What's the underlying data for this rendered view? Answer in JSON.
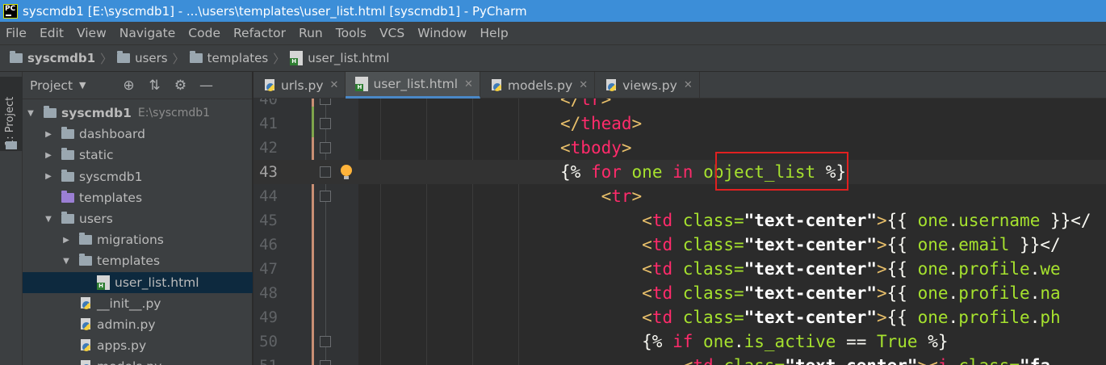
{
  "window": {
    "title": "syscmdb1 [E:\\syscmdb1] - ...\\users\\templates\\user_list.html [syscmdb1] - PyCharm",
    "app_icon_text": "PC"
  },
  "menu": [
    "File",
    "Edit",
    "View",
    "Navigate",
    "Code",
    "Refactor",
    "Run",
    "Tools",
    "VCS",
    "Window",
    "Help"
  ],
  "breadcrumbs": [
    "syscmdb1",
    "users",
    "templates",
    "user_list.html"
  ],
  "tool_window_stripe": {
    "label": "1: Project"
  },
  "project_panel": {
    "title": "Project",
    "tree": [
      {
        "label": "syscmdb1",
        "path": "E:\\syscmdb1",
        "arrow": "▼",
        "icon": "folder",
        "bold": true
      },
      {
        "label": "dashboard",
        "arrow": "▶",
        "icon": "folder"
      },
      {
        "label": "static",
        "arrow": "▶",
        "icon": "folder"
      },
      {
        "label": "syscmdb1",
        "arrow": "▶",
        "icon": "folder"
      },
      {
        "label": "templates",
        "arrow": "",
        "icon": "folder-purple"
      },
      {
        "label": "users",
        "arrow": "▼",
        "icon": "folder"
      },
      {
        "label": "migrations",
        "arrow": "▶",
        "icon": "folder"
      },
      {
        "label": "templates",
        "arrow": "▼",
        "icon": "folder"
      },
      {
        "label": "user_list.html",
        "arrow": "",
        "icon": "html-file",
        "selected": true
      },
      {
        "label": "__init__.py",
        "arrow": "",
        "icon": "python-file"
      },
      {
        "label": "admin.py",
        "arrow": "",
        "icon": "python-file"
      },
      {
        "label": "apps.py",
        "arrow": "",
        "icon": "python-file"
      },
      {
        "label": "models.py",
        "arrow": "",
        "icon": "python-file"
      }
    ]
  },
  "tabs": [
    {
      "label": "urls.py",
      "icon": "python-file",
      "active": false
    },
    {
      "label": "user_list.html",
      "icon": "html-file",
      "active": true
    },
    {
      "label": "models.py",
      "icon": "python-file",
      "active": false
    },
    {
      "label": "views.py",
      "icon": "python-file",
      "active": false
    }
  ],
  "editor": {
    "current_line": 43,
    "lines": [
      {
        "no": "40",
        "tokens": [
          [
            "t-br",
            "</"
          ],
          [
            "tagname",
            "tr"
          ],
          [
            "t-br",
            ">"
          ]
        ]
      },
      {
        "no": "41",
        "tokens": [
          [
            "t-br",
            "</"
          ],
          [
            "tagname",
            "thead"
          ],
          [
            "t-br",
            ">"
          ]
        ]
      },
      {
        "no": "42",
        "tokens": [
          [
            "t-br",
            "<"
          ],
          [
            "tagname",
            "tbody"
          ],
          [
            "t-br",
            ">"
          ]
        ]
      },
      {
        "no": "43",
        "tokens": [
          [
            "plain",
            "{% "
          ],
          [
            "kw",
            "for"
          ],
          [
            "plain",
            " "
          ],
          [
            "var",
            "one"
          ],
          [
            "plain",
            " "
          ],
          [
            "kw",
            "in"
          ],
          [
            "plain",
            " "
          ],
          [
            "var",
            "object_list"
          ],
          [
            "plain",
            " %}"
          ]
        ]
      },
      {
        "no": "44",
        "tokens": [
          [
            "plain",
            "    "
          ],
          [
            "t-br",
            "<"
          ],
          [
            "tagname",
            "tr"
          ],
          [
            "t-br",
            ">"
          ]
        ]
      },
      {
        "no": "45",
        "tokens": [
          [
            "plain",
            "        "
          ],
          [
            "t-br",
            "<"
          ],
          [
            "tagname",
            "td"
          ],
          [
            "plain",
            " "
          ],
          [
            "attr",
            "class="
          ],
          [
            "str",
            "\"text-center\""
          ],
          [
            "t-br",
            ">"
          ],
          [
            "plain",
            "{{ "
          ],
          [
            "var",
            "one"
          ],
          [
            "plain",
            "."
          ],
          [
            "var",
            "username"
          ],
          [
            "plain",
            " }}</"
          ]
        ]
      },
      {
        "no": "46",
        "tokens": [
          [
            "plain",
            "        "
          ],
          [
            "t-br",
            "<"
          ],
          [
            "tagname",
            "td"
          ],
          [
            "plain",
            " "
          ],
          [
            "attr",
            "class="
          ],
          [
            "str",
            "\"text-center\""
          ],
          [
            "t-br",
            ">"
          ],
          [
            "plain",
            "{{ "
          ],
          [
            "var",
            "one"
          ],
          [
            "plain",
            "."
          ],
          [
            "var",
            "email"
          ],
          [
            "plain",
            " }}</"
          ]
        ]
      },
      {
        "no": "47",
        "tokens": [
          [
            "plain",
            "        "
          ],
          [
            "t-br",
            "<"
          ],
          [
            "tagname",
            "td"
          ],
          [
            "plain",
            " "
          ],
          [
            "attr",
            "class="
          ],
          [
            "str",
            "\"text-center\""
          ],
          [
            "t-br",
            ">"
          ],
          [
            "plain",
            "{{ "
          ],
          [
            "var",
            "one"
          ],
          [
            "plain",
            "."
          ],
          [
            "var",
            "profile"
          ],
          [
            "plain",
            "."
          ],
          [
            "var",
            "we"
          ]
        ]
      },
      {
        "no": "48",
        "tokens": [
          [
            "plain",
            "        "
          ],
          [
            "t-br",
            "<"
          ],
          [
            "tagname",
            "td"
          ],
          [
            "plain",
            " "
          ],
          [
            "attr",
            "class="
          ],
          [
            "str",
            "\"text-center\""
          ],
          [
            "t-br",
            ">"
          ],
          [
            "plain",
            "{{ "
          ],
          [
            "var",
            "one"
          ],
          [
            "plain",
            "."
          ],
          [
            "var",
            "profile"
          ],
          [
            "plain",
            "."
          ],
          [
            "var",
            "na"
          ]
        ]
      },
      {
        "no": "49",
        "tokens": [
          [
            "plain",
            "        "
          ],
          [
            "t-br",
            "<"
          ],
          [
            "tagname",
            "td"
          ],
          [
            "plain",
            " "
          ],
          [
            "attr",
            "class="
          ],
          [
            "str",
            "\"text-center\""
          ],
          [
            "t-br",
            ">"
          ],
          [
            "plain",
            "{{ "
          ],
          [
            "var",
            "one"
          ],
          [
            "plain",
            "."
          ],
          [
            "var",
            "profile"
          ],
          [
            "plain",
            "."
          ],
          [
            "var",
            "ph"
          ]
        ]
      },
      {
        "no": "50",
        "tokens": [
          [
            "plain",
            "        {% "
          ],
          [
            "kw",
            "if"
          ],
          [
            "plain",
            " "
          ],
          [
            "var",
            "one"
          ],
          [
            "plain",
            "."
          ],
          [
            "var",
            "is_active"
          ],
          [
            "plain",
            " == "
          ],
          [
            "var",
            "True"
          ],
          [
            "plain",
            " %}"
          ]
        ]
      },
      {
        "no": "51",
        "tokens": [
          [
            "plain",
            "            "
          ],
          [
            "t-br",
            "<"
          ],
          [
            "tagname",
            "td"
          ],
          [
            "plain",
            " "
          ],
          [
            "attr",
            "class="
          ],
          [
            "str",
            "\"text-center\""
          ],
          [
            "t-br",
            ">"
          ],
          [
            "t-br",
            "<"
          ],
          [
            "tagname",
            "i"
          ],
          [
            "plain",
            " "
          ],
          [
            "attr",
            "class="
          ],
          [
            "str",
            "\"fa"
          ]
        ]
      }
    ]
  },
  "colors": {
    "title_bar": "#3c8ed8",
    "panel_bg": "#3c3f41",
    "editor_bg": "#2b2b2b",
    "selection": "#0d293e",
    "annotation_box": "#e02020"
  }
}
